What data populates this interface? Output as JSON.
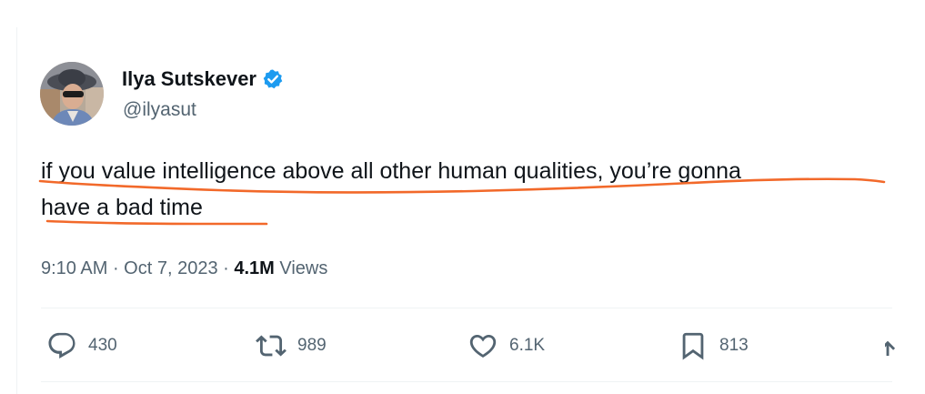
{
  "author": {
    "display_name": "Ilya Sutskever",
    "handle": "@ilyasut",
    "verified": true
  },
  "tweet": {
    "line1": "if you value intelligence above all other human qualities, you’re gonna",
    "line2": "have a bad time"
  },
  "meta": {
    "time": "9:10 AM",
    "separator1": " · ",
    "date": "Oct 7, 2023",
    "separator2": " · ",
    "views_count": "4.1M",
    "views_label": " Views"
  },
  "actions": {
    "replies": "430",
    "reposts": "989",
    "likes": "6.1K",
    "bookmarks": "813"
  },
  "colors": {
    "text_primary": "#0f1419",
    "text_secondary": "#536471",
    "verified_blue": "#1d9bf0",
    "annotation_orange": "#f2692a",
    "divider": "#eff3f4"
  },
  "icons": {
    "reply": "reply-icon",
    "repost": "repost-icon",
    "like": "heart-icon",
    "bookmark": "bookmark-icon",
    "share": "share-icon",
    "verified": "verified-badge-icon"
  }
}
